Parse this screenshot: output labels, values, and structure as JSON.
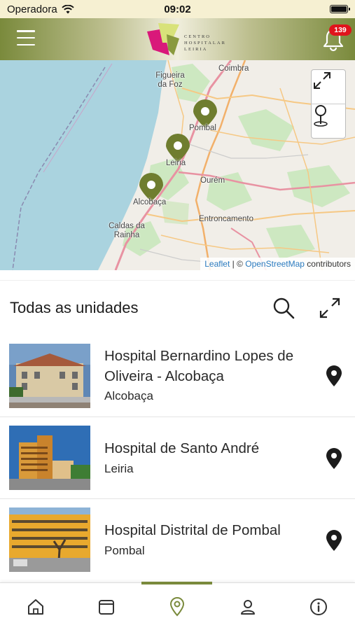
{
  "status_bar": {
    "carrier": "Operadora",
    "time": "09:02"
  },
  "header": {
    "logo_text": [
      "CENTRO",
      "HOSPITALAR",
      "LEIRIA"
    ],
    "notifications_count": "139"
  },
  "map": {
    "places": [
      "Figueira da Foz",
      "Coimbra",
      "Pombal",
      "Leiria",
      "Ourém",
      "Alcobaça",
      "Caldas da Rainha",
      "Entroncamento"
    ],
    "attribution_leaflet": "Leaflet",
    "attribution_sep": " | © ",
    "attribution_osm": "OpenStreetMap",
    "attribution_contrib": " contributors"
  },
  "list": {
    "title": "Todas as unidades",
    "hospitals": [
      {
        "name": "Hospital Bernardino Lopes de Oliveira - Alcobaça",
        "city": "Alcobaça"
      },
      {
        "name": "Hospital de Santo André",
        "city": "Leiria"
      },
      {
        "name": "Hospital Distrital de Pombal",
        "city": "Pombal"
      }
    ]
  },
  "tabs": [
    {
      "icon": "home-icon"
    },
    {
      "icon": "calendar-icon"
    },
    {
      "icon": "map-pin-icon",
      "active": true
    },
    {
      "icon": "user-icon"
    },
    {
      "icon": "info-icon"
    }
  ],
  "colors": {
    "accent": "#7a8a3c",
    "badge": "#e0141c",
    "sea": "#aad3df",
    "marker": "#6f7d2f"
  }
}
